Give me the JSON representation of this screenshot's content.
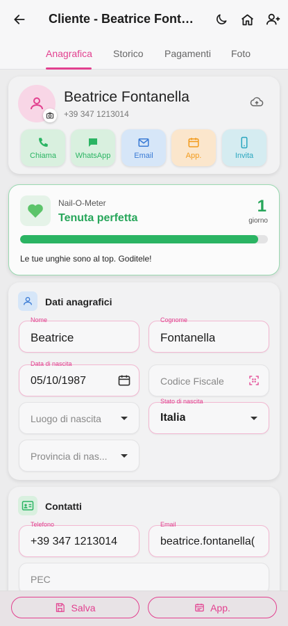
{
  "header": {
    "title": "Cliente - Beatrice Fontanella"
  },
  "tabs": [
    {
      "label": "Anagrafica"
    },
    {
      "label": "Storico"
    },
    {
      "label": "Pagamenti"
    },
    {
      "label": "Foto"
    }
  ],
  "profile": {
    "name": "Beatrice Fontanella",
    "phone": "+39 347 1213014",
    "actions": [
      {
        "label": "Chiama",
        "color": "#2bb463",
        "bg": "#d9f0df"
      },
      {
        "label": "WhatsApp",
        "color": "#2bb463",
        "bg": "#d9f0df"
      },
      {
        "label": "Email",
        "color": "#3a7bd5",
        "bg": "#d6e6f8"
      },
      {
        "label": "App.",
        "color": "#f29a1b",
        "bg": "#fbe6cc"
      },
      {
        "label": "Invita",
        "color": "#2aa6bf",
        "bg": "#d5ecf1"
      }
    ]
  },
  "nail_o_meter": {
    "label": "Nail-O-Meter",
    "status": "Tenuta perfetta",
    "count": "1",
    "unit": "giorno",
    "progress": 0.96,
    "message": "Le tue unghie sono al top. Goditele!"
  },
  "anagrafica": {
    "title": "Dati anagrafici",
    "nome": {
      "label": "Nome",
      "value": "Beatrice"
    },
    "cognome": {
      "label": "Cognome",
      "value": "Fontanella"
    },
    "data_nascita": {
      "label": "Data di nascita",
      "value": "05/10/1987"
    },
    "codice_fiscale": {
      "placeholder": "Codice Fiscale"
    },
    "luogo_nascita": {
      "placeholder": "Luogo di nascita"
    },
    "stato_nascita": {
      "label": "Stato di nascita",
      "value": "Italia"
    },
    "provincia_nascita": {
      "placeholder": "Provincia di nas..."
    }
  },
  "contatti": {
    "title": "Contatti",
    "telefono": {
      "label": "Telefono",
      "value": "+39 347 1213014"
    },
    "email": {
      "label": "Email",
      "value": "beatrice.fontanella("
    },
    "pec": {
      "placeholder": "PEC"
    }
  },
  "bottom": {
    "save_label": "Salva",
    "app_label": "App."
  },
  "colors": {
    "accent": "#e2408f",
    "success": "#2bb463"
  }
}
